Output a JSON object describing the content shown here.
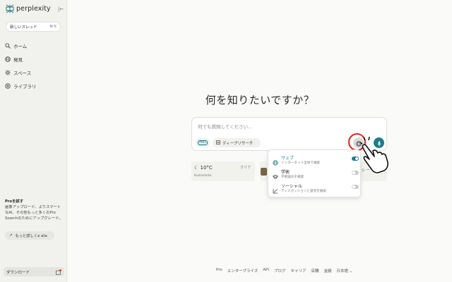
{
  "app": {
    "logo_text": "perplexity",
    "collapse_label": "|←"
  },
  "sidebar": {
    "new_thread_label": "新しいスレッド",
    "new_thread_shortcut": "⌘ K",
    "items": [
      {
        "label": "ホーム",
        "icon": "search-icon"
      },
      {
        "label": "発見",
        "icon": "globe-icon"
      },
      {
        "label": "スペース",
        "icon": "spaces-icon"
      },
      {
        "label": "ライブラリ",
        "icon": "library-icon"
      }
    ],
    "promo": {
      "title": "Proを試す",
      "body": "画像アップロード、よりスマートなAI、その他もっと多くのPro Searchのためにアップグレード。",
      "learn_more": "もっと詳しくe ata"
    },
    "download_label": "ダウンロード"
  },
  "main": {
    "heading": "何を知りたいですか？",
    "search": {
      "placeholder": "何でも質問してください...",
      "pro_label": "PRO",
      "deep_research_label": "ディープリサーチ"
    },
    "weather": {
      "temp": "10°C",
      "condition": "クリア",
      "location": "Kumamoto"
    },
    "card3_text": "シ ー",
    "focus_menu": [
      {
        "label": "ウェブ",
        "desc": "インターネット全体で検索",
        "enabled": true,
        "icon": "web-icon"
      },
      {
        "label": "学術",
        "desc": "学術論文を検索",
        "enabled": false,
        "icon": "academic-icon"
      },
      {
        "label": "ソーシャル",
        "desc": "ディスカッションと意見を検索",
        "enabled": false,
        "icon": "social-icon"
      }
    ]
  },
  "footer": {
    "links": [
      "Pro",
      "エンタープライズ",
      "API",
      "ブログ",
      "キャリア",
      "店舗",
      "金融",
      "日本語 ⌄"
    ]
  },
  "colors": {
    "accent": "#1e7c86",
    "highlight_ring": "#e0241c"
  }
}
